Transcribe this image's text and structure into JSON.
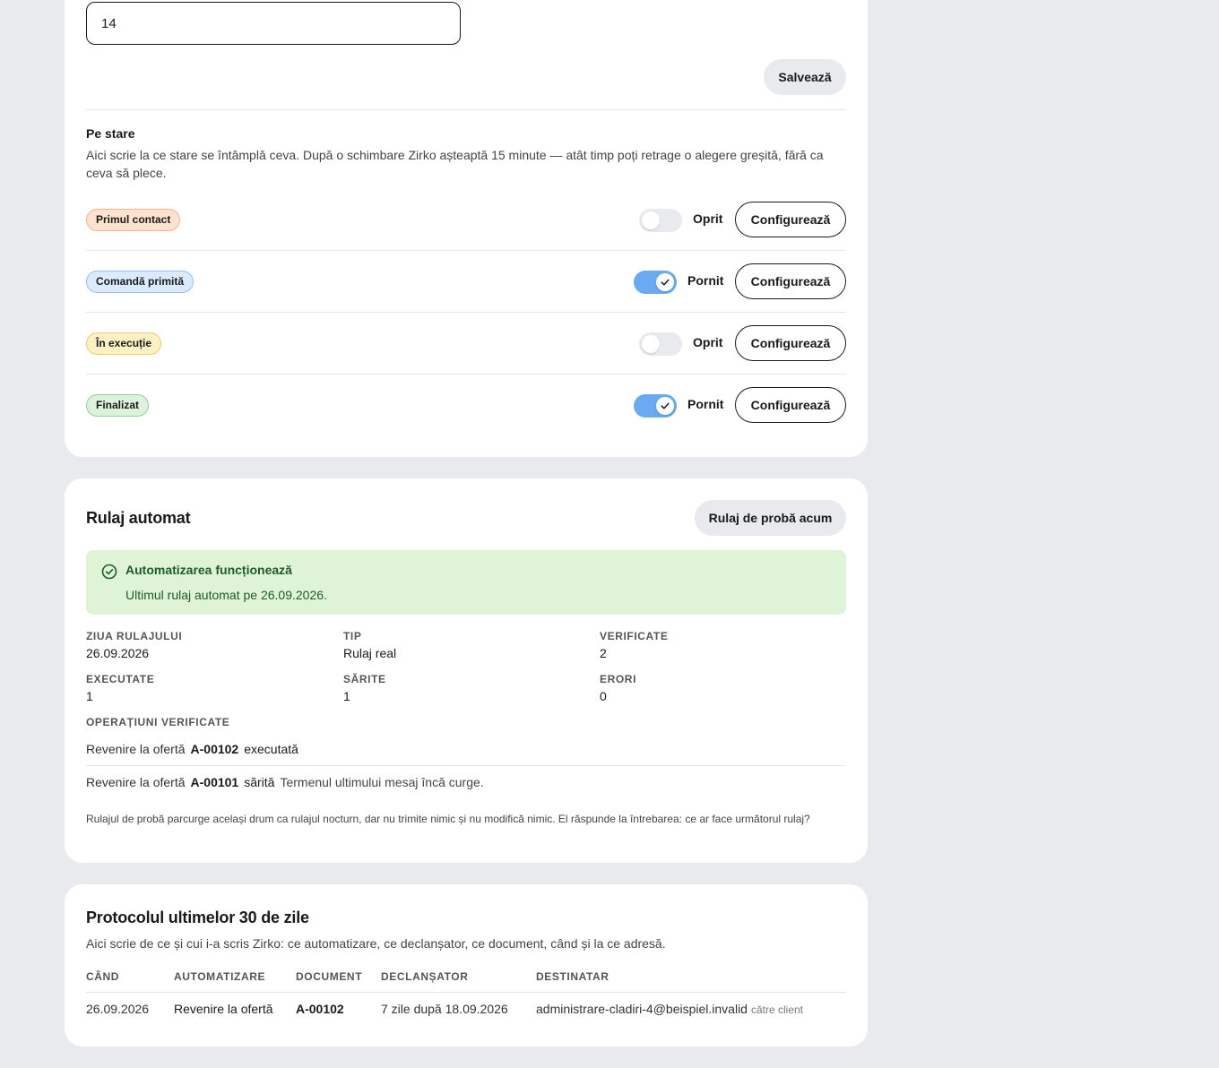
{
  "settings": {
    "days_value": "14",
    "save_label": "Salvează"
  },
  "per_state": {
    "title": "Pe stare",
    "description": "Aici scrie la ce stare se întâmplă ceva. După o schimbare Zirko așteaptă 15 minute — atât timp poți retrage o alegere greșită, fără ca ceva să plece.",
    "configure_label": "Configurează",
    "states": [
      {
        "name": "Primul contact",
        "enabled": false,
        "toggle_label": "Oprit",
        "badge_bg": "#fde2cf",
        "badge_border": "#f0b48a"
      },
      {
        "name": "Comandă primită",
        "enabled": true,
        "toggle_label": "Pornit",
        "badge_bg": "#dbeaff",
        "badge_border": "#95c0ee"
      },
      {
        "name": "În execuție",
        "enabled": false,
        "toggle_label": "Oprit",
        "badge_bg": "#fdf0c4",
        "badge_border": "#e8cd6e"
      },
      {
        "name": "Finalizat",
        "enabled": true,
        "toggle_label": "Pornit",
        "badge_bg": "#dcf2dc",
        "badge_border": "#97cd99"
      }
    ]
  },
  "auto_run": {
    "title": "Rulaj automat",
    "test_run_label": "Rulaj de probă acum",
    "status_title": "Automatizarea funcționează",
    "status_text": "Ultimul rulaj automat pe 26.09.2026.",
    "stats": [
      {
        "label": "ZIUA RULAJULUI",
        "value": "26.09.2026"
      },
      {
        "label": "TIP",
        "value": "Rulaj real"
      },
      {
        "label": "VERIFICATE",
        "value": "2"
      },
      {
        "label": "EXECUTATE",
        "value": "1"
      },
      {
        "label": "SĂRITE",
        "value": "1"
      },
      {
        "label": "ERORI",
        "value": "0"
      }
    ],
    "operations_label": "OPERAȚIUNI VERIFICATE",
    "operations": [
      {
        "action": "Revenire la ofertă",
        "code": "A-00102",
        "status": "executată",
        "note": ""
      },
      {
        "action": "Revenire la ofertă",
        "code": "A-00101",
        "status": "sărită",
        "note": "Termenul ultimului mesaj încă curge."
      }
    ],
    "footnote": "Rulajul de probă parcurge același drum ca rulajul nocturn, dar nu trimite nimic și nu modifică nimic. El răspunde la întrebarea: ce ar face următorul rulaj?"
  },
  "protocol": {
    "title": "Protocolul ultimelor 30 de zile",
    "description": "Aici scrie de ce și cui i-a scris Zirko: ce automatizare, ce declanșator, ce document, când și la ce adresă.",
    "columns": [
      "CÂND",
      "AUTOMATIZARE",
      "DOCUMENT",
      "DECLANȘATOR",
      "DESTINATAR"
    ],
    "rows": [
      {
        "when": "26.09.2026",
        "automation": "Revenire la ofertă",
        "document": "A-00102",
        "trigger": "7 zile după 18.09.2026",
        "recipient": "administrare-cladiri-4@beispiel.invalid",
        "recipient_note": "către client"
      }
    ]
  }
}
